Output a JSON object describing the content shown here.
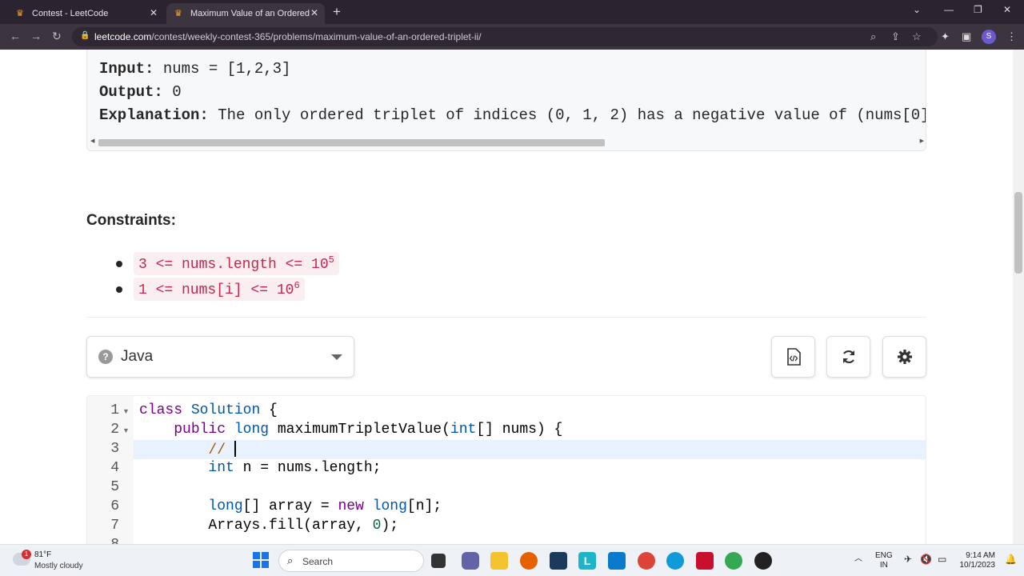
{
  "browser": {
    "tabs": [
      {
        "title": "Contest - LeetCode"
      },
      {
        "title": "Maximum Value of an Ordered T"
      }
    ],
    "url_host": "leetcode.com",
    "url_path": "/contest/weekly-contest-365/problems/maximum-value-of-an-ordered-triplet-ii/",
    "profile_initial": "S"
  },
  "example": {
    "input_label": "Input:",
    "input_value": "nums = [1,2,3]",
    "output_label": "Output:",
    "output_value": "0",
    "explanation_label": "Explanation:",
    "explanation_value": "The only ordered triplet of indices (0, 1, 2) has a negative value of (nums[0]"
  },
  "constraints": {
    "title": "Constraints:",
    "items": [
      {
        "text": "3 <= nums.length <= 10",
        "sup": "5"
      },
      {
        "text": "1 <= nums[i] <= 10",
        "sup": "6"
      }
    ]
  },
  "editor": {
    "language": "Java",
    "line_numbers": [
      "1",
      "2",
      "3",
      "4",
      "5",
      "6",
      "7",
      "8"
    ],
    "current_line": 3
  },
  "taskbar": {
    "weather_temp": "81°F",
    "weather_desc": "Mostly cloudy",
    "weather_badge": "1",
    "search_placeholder": "Search",
    "lang_top": "ENG",
    "lang_bottom": "IN",
    "time": "9:14 AM",
    "date": "10/1/2023"
  }
}
